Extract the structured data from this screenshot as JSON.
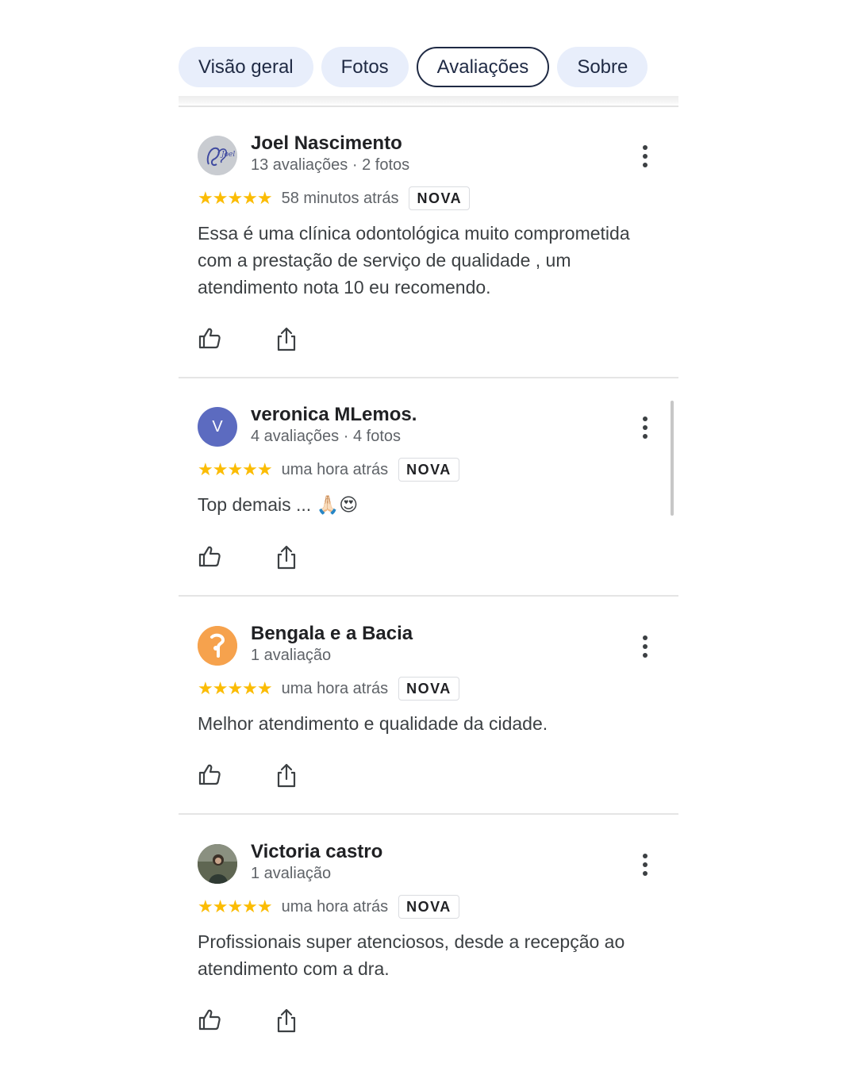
{
  "tabs": [
    {
      "label": "Visão geral",
      "active": false
    },
    {
      "label": "Fotos",
      "active": false
    },
    {
      "label": "Avaliações",
      "active": true
    },
    {
      "label": "Sobre",
      "active": false
    }
  ],
  "colors": {
    "star": "#fbbc04",
    "tab_bg": "#e8eefb",
    "avatar_v": "#5c6bc0",
    "avatar_bengala": "#f6a24d"
  },
  "reviews": [
    {
      "name": "Joel Nascimento",
      "meta": "13 avaliações · 2 fotos",
      "stars": "★★★★★",
      "rating": 5,
      "time": "58 minutos atrás",
      "badge": "NOVA",
      "text": "Essa é uma clínica odontológica muito comprometida com a prestação de serviço de qualidade , um atendimento nota 10 eu recomendo.",
      "avatar_icon": "profile-photo"
    },
    {
      "name": "veronica MLemos.",
      "meta": "4 avaliações · 4 fotos",
      "stars": "★★★★★",
      "rating": 5,
      "time": "uma hora atrás",
      "badge": "NOVA",
      "text": "Top demais ... 🙏🏻😍",
      "avatar_letter": "V"
    },
    {
      "name": "Bengala e a Bacia",
      "meta": "1 avaliação",
      "stars": "★★★★★",
      "rating": 5,
      "time": "uma hora atrás",
      "badge": "NOVA",
      "text": "Melhor atendimento e qualidade da cidade.",
      "avatar_icon": "bengala-logo"
    },
    {
      "name": "Victoria castro",
      "meta": "1 avaliação",
      "stars": "★★★★★",
      "rating": 5,
      "time": "uma hora atrás",
      "badge": "NOVA",
      "text": "Profissionais super atenciosos, desde a recepção ao atendimento com a dra.",
      "avatar_icon": "profile-photo"
    }
  ]
}
